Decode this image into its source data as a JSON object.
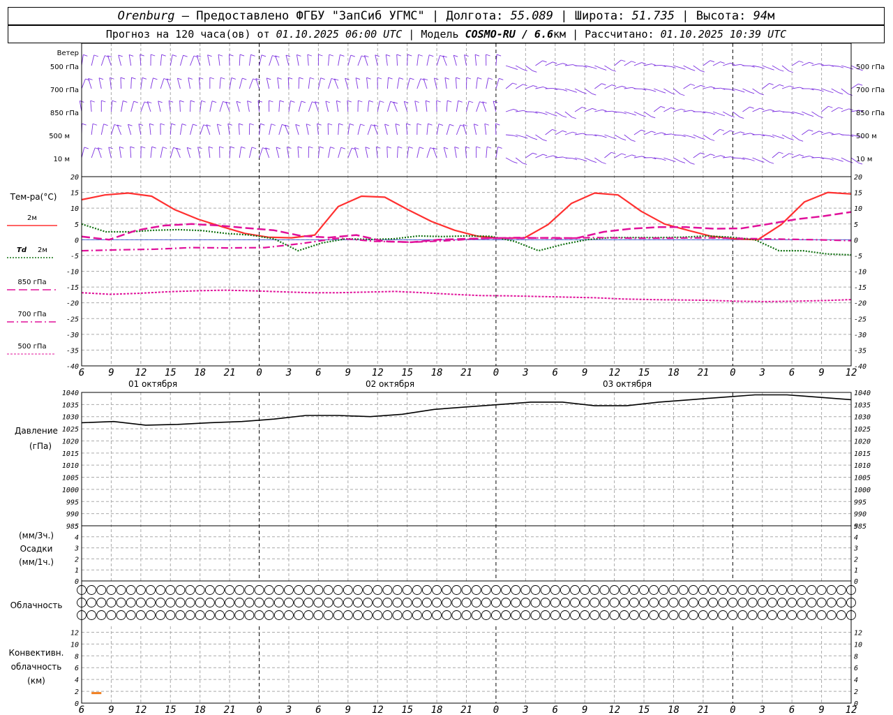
{
  "header": {
    "city": "Orenburg",
    "provider": " — Предоставлено ФГБУ \"ЗапСиб УГМС\" | Долгота: ",
    "lon": "55.089",
    "lat_label": " | Широта: ",
    "lat": "51.735",
    "alt_label": " | Высота: ",
    "alt": "94",
    "alt_unit": "м",
    "forecast_label": "Прогноз на 120 часа(ов) от ",
    "forecast_start": "01.10.2025 06:00 UTC",
    "model_label": " | Модель ",
    "model": "COSMO-RU / 6.6",
    "model_unit": "км",
    "calc_label": " | Рассчитано: ",
    "calc_time": "01.10.2025 10:39 UTC"
  },
  "wind_panel": {
    "title": "Ветер",
    "levels": [
      "500 гПа",
      "700 гПа",
      "850 гПа",
      "500 м",
      "10 м"
    ],
    "color": "#7b2fe0"
  },
  "temp_panel": {
    "title": "Тем-ра(°C)",
    "legend": [
      {
        "label": "2м",
        "italic": "",
        "color": "#ff3030",
        "dash": ""
      },
      {
        "label": "2м",
        "italic": "Td",
        "color": "#107010",
        "dash": "2 2"
      },
      {
        "label": "850 гПа",
        "italic": "",
        "color": "#e0109a",
        "dash": "12 5"
      },
      {
        "label": "700 гПа",
        "italic": "",
        "color": "#e0109a",
        "dash": "10 4 2 4"
      },
      {
        "label": "500 гПа",
        "italic": "",
        "color": "#e0109a",
        "dash": "3 2"
      }
    ]
  },
  "pressure_panel": {
    "title1": "Давление",
    "title2": "(гПа)"
  },
  "precip_panel": {
    "title1": "(мм/3ч.)",
    "title2": "Осадки",
    "title3": "(мм/1ч.)"
  },
  "cloud_panel": {
    "title": "Облачность"
  },
  "conv_panel": {
    "title1": "Конвективн.",
    "title2": "облачность",
    "title3": "(км)"
  },
  "day_labels": [
    "01 октября",
    "02 октября",
    "03 октября"
  ],
  "x_tick_labels": [
    "6",
    "9",
    "12",
    "15",
    "18",
    "21",
    "0",
    "3",
    "6",
    "9",
    "12",
    "15",
    "18",
    "21",
    "0",
    "3",
    "6",
    "9",
    "12",
    "15",
    "18",
    "21",
    "0",
    "3",
    "6",
    "9",
    "12"
  ],
  "chart_data": [
    {
      "type": "line",
      "title": "Тем-ра(°C)",
      "x": [
        6,
        9,
        12,
        15,
        18,
        21,
        24,
        27,
        30,
        33,
        36,
        39,
        42,
        45,
        48,
        51,
        54,
        57,
        60,
        63,
        66,
        69,
        72,
        75,
        78,
        81,
        84
      ],
      "ylim": [
        -40,
        20
      ],
      "yticks": [
        20,
        15,
        10,
        5,
        0,
        -5,
        -10,
        -15,
        -20,
        -25,
        -30,
        -35,
        -40
      ],
      "series": [
        {
          "name": "2м",
          "color": "#ff3030",
          "values": [
            12.7,
            14.2,
            14.8,
            13.8,
            9.5,
            6.5,
            4.2,
            2.0,
            0.8,
            0.6,
            1.5,
            10.5,
            13.8,
            13.5,
            9.5,
            5.8,
            3.0,
            1.1,
            0.5,
            0.6,
            4.8,
            11.5,
            14.8,
            14.2,
            9.0,
            5.0,
            3.0,
            1.1,
            0.3,
            0.0,
            4.8,
            12.0,
            15.0,
            14.5
          ]
        },
        {
          "name": "Td 2м",
          "color": "#107010",
          "values": [
            5.0,
            2.5,
            2.5,
            3.0,
            3.2,
            2.9,
            2.0,
            1.5,
            0.3,
            -3.5,
            -1.0,
            0.3,
            0.1,
            0.3,
            1.2,
            1.0,
            1.2,
            1.1,
            -0.5,
            -3.5,
            -1.5,
            0.0,
            0.7,
            0.7,
            0.7,
            0.8,
            1.2,
            0.8,
            0.0,
            -3.5,
            -3.5,
            -4.5,
            -4.8
          ]
        },
        {
          "name": "850 гПа",
          "color": "#e0109a",
          "values": [
            1.0,
            0.0,
            3.0,
            4.5,
            5.0,
            4.5,
            3.7,
            3.0,
            1.2,
            0.7,
            1.5,
            -0.5,
            -0.8,
            0.0,
            0.3,
            0.5,
            0.5,
            0.6,
            0.5,
            2.5,
            3.5,
            4.0,
            4.0,
            3.5,
            3.6,
            5.0,
            6.5,
            7.5,
            8.8
          ]
        },
        {
          "name": "700 гПа",
          "color": "#e0109a",
          "values": [
            -3.5,
            -3.2,
            -3.0,
            -2.5,
            -2.6,
            -2.5,
            -1.2,
            0.5,
            -0.5,
            -0.8,
            -0.3,
            0.5,
            0.7,
            0.4,
            0.7,
            0.5,
            0.5,
            0.6,
            0.4,
            0.2,
            0.0,
            -0.3
          ]
        },
        {
          "name": "500 гПа",
          "color": "#e0109a",
          "values": [
            -16.8,
            -17.3,
            -17.0,
            -16.5,
            -16.2,
            -16.0,
            -16.2,
            -16.5,
            -16.8,
            -16.8,
            -16.6,
            -16.4,
            -16.8,
            -17.3,
            -17.7,
            -17.8,
            -18.0,
            -18.2,
            -18.4,
            -18.8,
            -19.0,
            -19.1,
            -19.2,
            -19.5,
            -19.6,
            -19.5,
            -19.3,
            -19.0
          ]
        }
      ]
    },
    {
      "type": "line",
      "title": "Давление (гПа)",
      "x": [
        6,
        8,
        12,
        16,
        20,
        24,
        28,
        32,
        36,
        40,
        44,
        48,
        52,
        56,
        60,
        64,
        68,
        72,
        76,
        80,
        84,
        88,
        90
      ],
      "ylim": [
        985,
        1040
      ],
      "yticks": [
        1040,
        1035,
        1030,
        1025,
        1020,
        1015,
        1010,
        1005,
        1000,
        995,
        990,
        985
      ],
      "series": [
        {
          "name": "Давление",
          "color": "#000000",
          "values": [
            1027.5,
            1028.0,
            1026.5,
            1026.8,
            1027.5,
            1028.0,
            1029.0,
            1030.5,
            1030.5,
            1030.0,
            1031.0,
            1033.0,
            1034.0,
            1035.0,
            1036.0,
            1036.0,
            1034.5,
            1034.5,
            1036.0,
            1037.0,
            1038.0,
            1039.0,
            1039.0,
            1038.0,
            1037.0
          ]
        }
      ]
    },
    {
      "type": "bar",
      "title": "Осадки",
      "ylim": [
        0,
        5
      ],
      "yticks": [
        5,
        4,
        3,
        2,
        1,
        0
      ],
      "values": []
    },
    {
      "type": "bar",
      "title": "Конвективн. облачность (км)",
      "ylim": [
        0,
        13
      ],
      "yticks": [
        12,
        10,
        8,
        6,
        4,
        2,
        0
      ],
      "segments": [
        {
          "x_start": 7,
          "x_end": 8,
          "y": 1.7,
          "color": "#f07f20"
        }
      ]
    }
  ],
  "clouds": {
    "rows": [
      {
        "name": "high",
        "values": "000000000000000000000000000000000000000000000000000000000000000000000000000000000000000000000000000000000000000000000"
      },
      {
        "name": "mid",
        "values": "000000000000000000000000000000000000000000000000000000000000000000000000000000000000000000000000000000000000000000000"
      },
      {
        "name": "low",
        "values": "000000000000000000000000000000000000000000000000000000000000000000000000000000000000000000000000000000000000000000000"
      }
    ]
  }
}
